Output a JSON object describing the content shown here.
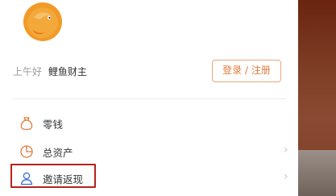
{
  "colors": {
    "accent": "#e07b3c",
    "highlight_border": "#b5221b",
    "text": "#333333"
  },
  "header": {
    "greeting": "上午好",
    "username": "鲤鱼财主",
    "login_label": "登录 / 注册",
    "avatar_icon": "koi-fish-logo-icon"
  },
  "menu": {
    "items": [
      {
        "label": "零钱",
        "icon": "coin-pouch-icon"
      },
      {
        "label": "总资产",
        "icon": "pie-chart-icon"
      },
      {
        "label": "邀请返现",
        "icon": "user-icon"
      }
    ]
  }
}
